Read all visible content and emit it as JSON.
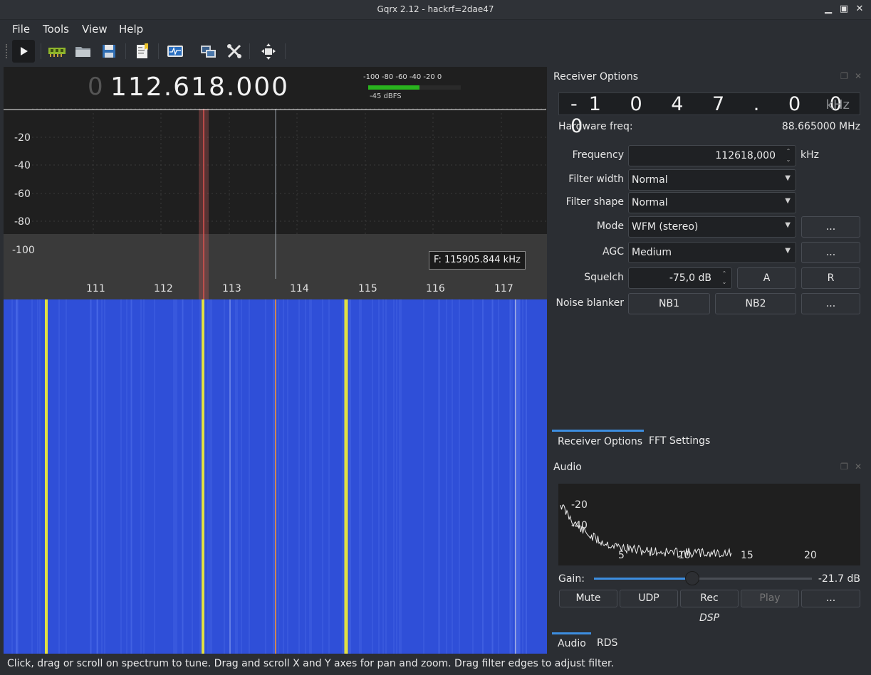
{
  "window": {
    "title": "Gqrx 2.12 - hackrf=2dae47"
  },
  "menu": {
    "file": "File",
    "tools": "Tools",
    "view": "View",
    "help": "Help"
  },
  "toolbar": {
    "buttons": [
      "play-icon",
      "device-icon",
      "open-icon",
      "save-icon",
      "bookmark-icon",
      "display-icon",
      "remote-icon",
      "settings-icon",
      "fullscreen-icon"
    ]
  },
  "spectrum": {
    "freq_dim": "0",
    "freq_main": "112.618.000",
    "y_labels": [
      "-20",
      "-40",
      "-60",
      "-80",
      "-100"
    ],
    "x_labels": [
      "111",
      "112",
      "113",
      "114",
      "115",
      "116",
      "117"
    ],
    "smeter_scale": "-100  -80   -60  -40   -20     0",
    "smeter_label": "-45 dBFS",
    "smeter_level_dbfs": -45,
    "tooltip": "F: 115905.844 kHz",
    "colors": {
      "waterfall_bg": "#2f4fd8",
      "signal": "#f5f032",
      "filter": "#d9534f",
      "marker": "#ff9a2a"
    }
  },
  "receiver": {
    "title": "Receiver Options",
    "offset_digits": "-1  0 4 7 . 0 0 0",
    "offset_unit": "kHz",
    "hw_freq_label": "Hardware freq:",
    "hw_freq_value": "88.665000 MHz",
    "frequency_label": "Frequency",
    "frequency_value": "112618,000",
    "frequency_unit": "kHz",
    "filter_width_label": "Filter width",
    "filter_width_value": "Normal",
    "filter_shape_label": "Filter shape",
    "filter_shape_value": "Normal",
    "mode_label": "Mode",
    "mode_value": "WFM (stereo)",
    "agc_label": "AGC",
    "agc_value": "Medium",
    "squelch_label": "Squelch",
    "squelch_value": "-75,0 dB",
    "squelch_a": "A",
    "squelch_r": "R",
    "noise_label": "Noise blanker",
    "nb1": "NB1",
    "nb2": "NB2",
    "more": "...",
    "tabs": [
      "Receiver Options",
      "FFT Settings"
    ]
  },
  "audio": {
    "title": "Audio",
    "y_labels": [
      "-20",
      "-40"
    ],
    "x_labels": [
      "5",
      "10",
      "15",
      "20"
    ],
    "gain_label": "Gain:",
    "gain_value": "-21.7 dB",
    "gain_fraction": 0.45,
    "mute": "Mute",
    "udp": "UDP",
    "rec": "Rec",
    "play": "Play",
    "more": "...",
    "dsp": "DSP",
    "tabs": [
      "Audio",
      "RDS"
    ]
  },
  "status": {
    "text": "Click, drag or scroll on spectrum to tune. Drag and scroll X and Y axes for pan and zoom. Drag filter edges to adjust filter."
  }
}
